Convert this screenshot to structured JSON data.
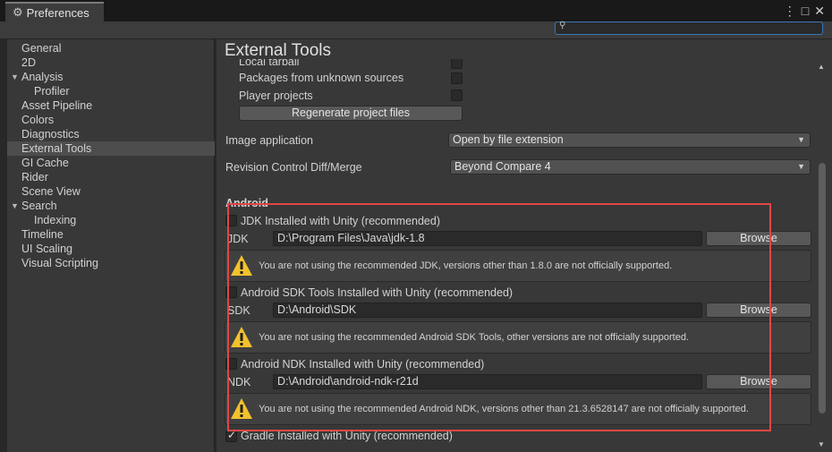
{
  "window": {
    "tab_title": "Preferences",
    "controls": [
      "⋮",
      "□",
      "✕"
    ]
  },
  "search": {
    "placeholder": ""
  },
  "sidebar": {
    "items": [
      {
        "label": "General",
        "indent": 0,
        "selected": false
      },
      {
        "label": "2D",
        "indent": 0,
        "selected": false
      },
      {
        "label": "Analysis",
        "indent": 0,
        "selected": false,
        "expanded": true
      },
      {
        "label": "Profiler",
        "indent": 1,
        "selected": false
      },
      {
        "label": "Asset Pipeline",
        "indent": 0,
        "selected": false
      },
      {
        "label": "Colors",
        "indent": 0,
        "selected": false
      },
      {
        "label": "Diagnostics",
        "indent": 0,
        "selected": false
      },
      {
        "label": "External Tools",
        "indent": 0,
        "selected": true
      },
      {
        "label": "GI Cache",
        "indent": 0,
        "selected": false
      },
      {
        "label": "Rider",
        "indent": 0,
        "selected": false
      },
      {
        "label": "Scene View",
        "indent": 0,
        "selected": false
      },
      {
        "label": "Search",
        "indent": 0,
        "selected": false,
        "expanded": true
      },
      {
        "label": "Indexing",
        "indent": 1,
        "selected": false
      },
      {
        "label": "Timeline",
        "indent": 0,
        "selected": false
      },
      {
        "label": "UI Scaling",
        "indent": 0,
        "selected": false
      },
      {
        "label": "Visual Scripting",
        "indent": 0,
        "selected": false
      }
    ]
  },
  "main": {
    "title": "External Tools",
    "local_tarball_label": "Local tarball",
    "packages_unknown_label": "Packages from unknown sources",
    "player_projects_label": "Player projects",
    "regenerate_button": "Regenerate project files",
    "image_app": {
      "label": "Image application",
      "value": "Open by file extension"
    },
    "revision_control": {
      "label": "Revision Control Diff/Merge",
      "value": "Beyond Compare 4"
    },
    "android_header": "Android",
    "jdk": {
      "checkbox_label": "JDK Installed with Unity (recommended)",
      "checked": false,
      "field_label": "JDK",
      "path": "D:\\Program Files\\Java\\jdk-1.8",
      "browse": "Browse",
      "warning": "You are not using the recommended JDK, versions other than 1.8.0 are not officially supported."
    },
    "sdk": {
      "checkbox_label": "Android SDK Tools Installed with Unity (recommended)",
      "checked": false,
      "field_label": "SDK",
      "path": "D:\\Android\\SDK",
      "browse": "Browse",
      "warning": "You are not using the recommended Android SDK Tools, other versions are not officially supported."
    },
    "ndk": {
      "checkbox_label": "Android NDK Installed with Unity (recommended)",
      "checked": false,
      "field_label": "NDK",
      "path": "D:\\Android\\android-ndk-r21d",
      "browse": "Browse",
      "warning": "You are not using the recommended Android NDK, versions other than 21.3.6528147 are not officially supported."
    },
    "gradle": {
      "checkbox_label": "Gradle Installed with Unity (recommended)",
      "checked": true
    }
  },
  "colors": {
    "highlight_box": "#e04646",
    "warning_icon": "#f2c12e",
    "search_border": "#3a79bb"
  }
}
